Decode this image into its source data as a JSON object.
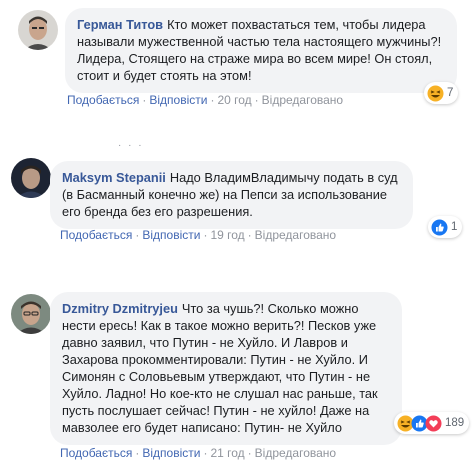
{
  "comments": [
    {
      "author": "Герман Титов",
      "text": "Кто может похвастаться тем, чтобы лидера называли мужественной частью тела настоящего мужчины?! Лидера, Стоящего на страже мира во всем мире! Он стоял, стоит и будет стоять на этом!",
      "actions": {
        "like": "Подобається",
        "reply": "Відповісти",
        "time": "20 год",
        "edited": "Відредаговано"
      },
      "reactions": {
        "icons": [
          "haha-icon"
        ],
        "count": "7"
      }
    },
    {
      "author": "Maksym Stepanii",
      "text": "Надо ВладимВладимычу подать в суд (в Басманный конечно же) на Пепси за использование его бренда без его разрешения.",
      "actions": {
        "like": "Подобається",
        "reply": "Відповісти",
        "time": "19 год",
        "edited": "Відредаговано"
      },
      "reactions": {
        "icons": [
          "like-icon"
        ],
        "count": "1"
      }
    },
    {
      "author": "Dzmitry Dzmitryjeu",
      "text": "Что за чушь?! Сколько можно нести ересь! Как в такое можно верить?! Песков уже давно заявил, что Путин - не Хуйло. И Лавров и Захарова прокомментировали: Путин - не Хуйло. И Симонян с Соловьевым утверждают, что Путин - не Хуйло. Ладно! Но кое-кто не слушал нас раньше, так пусть послушает сейчас! Путин - не хуйло! Даже на мавзолее его будет написано: Путин- не Хуйло",
      "actions": {
        "like": "Подобається",
        "reply": "Відповісти",
        "time": "21 год",
        "edited": "Відредаговано"
      },
      "reactions": {
        "icons": [
          "haha-icon",
          "like-icon",
          "love-icon"
        ],
        "count": "189"
      }
    }
  ],
  "separator": "· · ·",
  "dot": "·",
  "colors": {
    "author": "#385898",
    "link": "#4267b2",
    "bubble": "#f2f3f5",
    "muted": "#90949c",
    "like": "#1877f2",
    "love": "#f33e58",
    "haha": "#f7b125"
  }
}
